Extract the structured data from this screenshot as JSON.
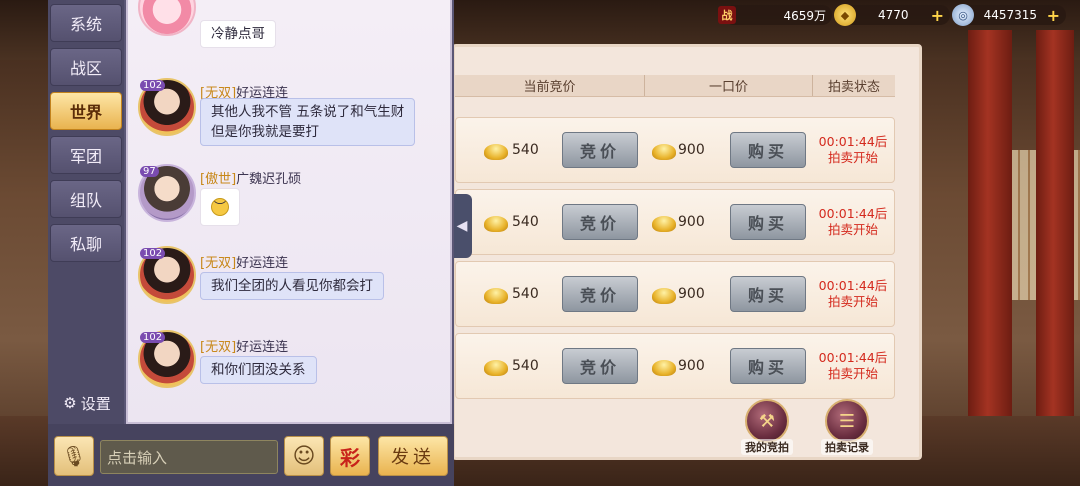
{
  "currency": {
    "power": {
      "icon": "battle-power-icon",
      "icon_text": "战",
      "value": "4659万"
    },
    "gold": {
      "icon": "gold-ingot-icon",
      "value": "4770"
    },
    "silver": {
      "icon": "silver-coin-icon",
      "value": "4457315"
    }
  },
  "chat": {
    "tabs": [
      "系统",
      "战区",
      "世界",
      "军团",
      "组队",
      "私聊"
    ],
    "active_tab": "世界",
    "settings_label": "设置",
    "messages": [
      {
        "level": "",
        "tag": "",
        "name": "",
        "text": "冷静点哥"
      },
      {
        "level": "102",
        "tag": "[无双]",
        "name": "好运连连",
        "lines": [
          "其他人我不管  五条说了和气生财",
          "但是你我就是要打"
        ]
      },
      {
        "level": "97",
        "tag": "[傲世]",
        "name": "广魏迟孔硕",
        "emoji": "😔"
      },
      {
        "level": "102",
        "tag": "[无双]",
        "name": "好运连连",
        "text": "我们全团的人看见你都会打"
      },
      {
        "level": "102",
        "tag": "[无双]",
        "name": "好运连连",
        "text": "和你们团没关系"
      }
    ],
    "input_placeholder": "点击输入",
    "color_button": "彩",
    "send_button": "发送"
  },
  "auction": {
    "headers": [
      "当前竞价",
      "一口价",
      "拍卖状态"
    ],
    "bid_label": "竞价",
    "buy_label": "购买",
    "rows": [
      {
        "bid_price": "540",
        "buy_price": "900",
        "status_time": "00:01:44后",
        "status_text": "拍卖开始"
      },
      {
        "bid_price": "540",
        "buy_price": "900",
        "status_time": "00:01:44后",
        "status_text": "拍卖开始"
      },
      {
        "bid_price": "540",
        "buy_price": "900",
        "status_time": "00:01:44后",
        "status_text": "拍卖开始"
      },
      {
        "bid_price": "540",
        "buy_price": "900",
        "status_time": "00:01:44后",
        "status_text": "拍卖开始"
      }
    ],
    "my_bids_label": "我的竞拍",
    "records_label": "拍卖记录"
  }
}
